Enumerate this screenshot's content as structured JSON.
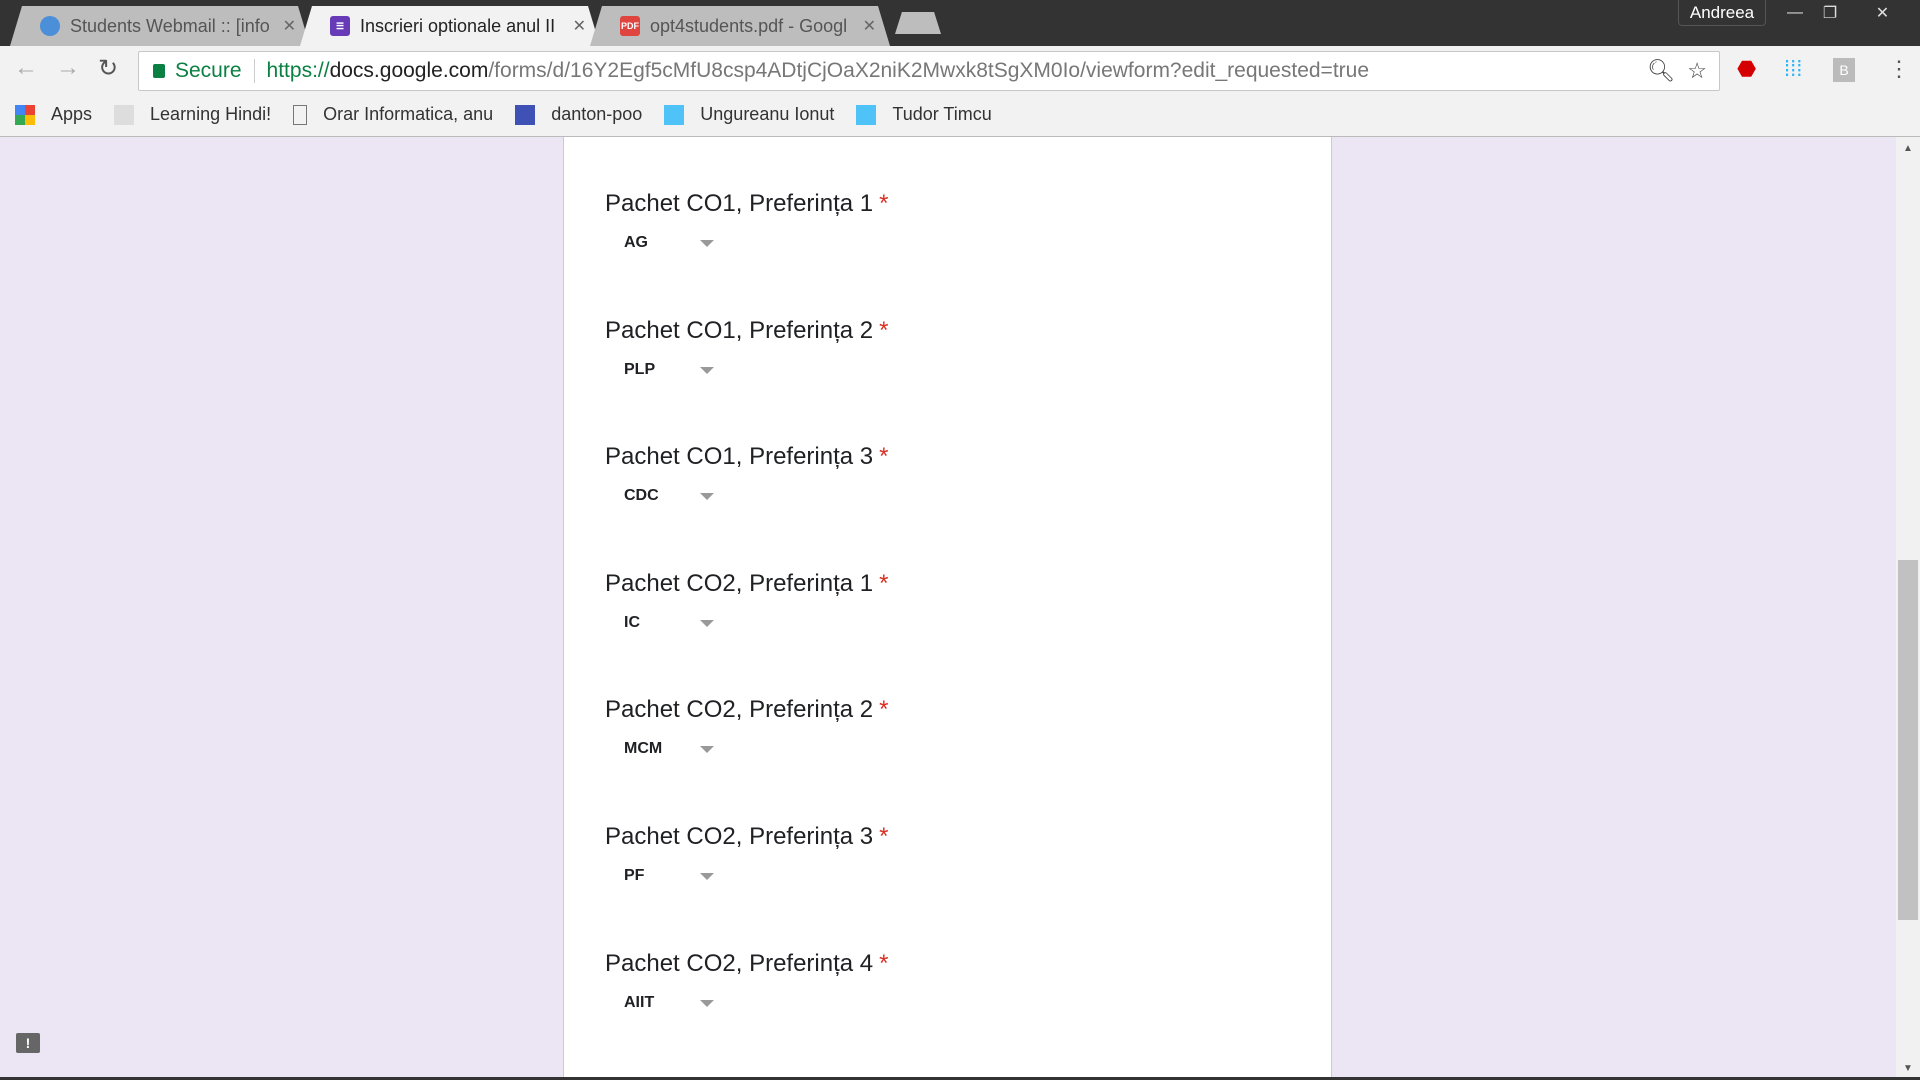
{
  "browser": {
    "tabs": [
      {
        "label": "Students Webmail :: [info",
        "active": false
      },
      {
        "label": "Inscrieri optionale anul II",
        "active": true
      },
      {
        "label": "opt4students.pdf - Googl",
        "active": false
      }
    ],
    "pdf_badge": "PDF",
    "profile": "Andreea",
    "secure_label": "Secure",
    "url": {
      "scheme": "https://",
      "host": "docs.google.com",
      "path": "/forms/d/16Y2Egf5cMfU8csp4ADtjCjOaX2niK2Mwxk8tSgXM0Io/viewform?edit_requested=true"
    },
    "extension_badge": "B",
    "bookmarks": [
      "Apps",
      "Learning Hindi!",
      "Orar Informatica, anu",
      "danton-poo",
      "Ungureanu Ionut",
      "Tudor Timcu"
    ]
  },
  "form": {
    "required_mark": "*",
    "questions": [
      {
        "title": "Pachet CO1, Preferința 1",
        "value": "AG"
      },
      {
        "title": "Pachet CO1, Preferința 2",
        "value": "PLP"
      },
      {
        "title": "Pachet CO1, Preferința 3",
        "value": "CDC"
      },
      {
        "title": "Pachet CO2, Preferința 1",
        "value": "IC"
      },
      {
        "title": "Pachet CO2, Preferința 2",
        "value": "MCM"
      },
      {
        "title": "Pachet CO2, Preferința 3",
        "value": "PF"
      },
      {
        "title": "Pachet CO2, Preferința 4",
        "value": "AIIT"
      }
    ]
  },
  "feedback_label": "!",
  "colors": {
    "page_bg": "#ece6f4",
    "required": "#d93025",
    "secure": "#0b8043"
  }
}
